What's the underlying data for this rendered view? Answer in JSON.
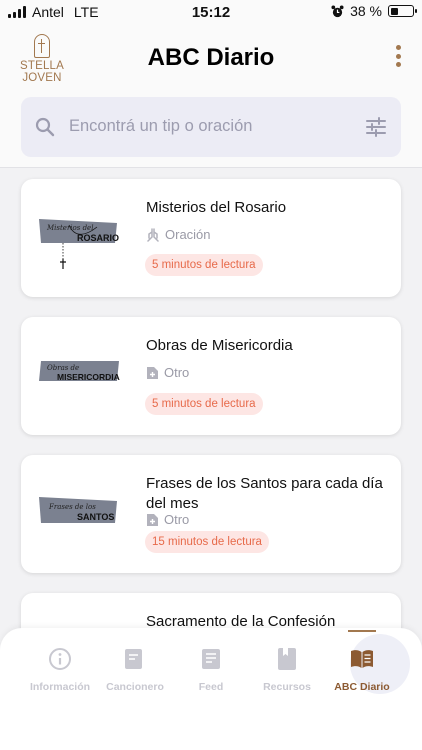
{
  "status_bar": {
    "carrier": "Antel",
    "network": "LTE",
    "time": "15:12",
    "battery": "38 %",
    "battery_level": 0.38,
    "alarm_icon": "alarm-clock-icon"
  },
  "header": {
    "logo": {
      "line1": "STELLA",
      "line2": "JOVEN",
      "color": "#a2784f"
    },
    "title": "ABC Diario",
    "menu_icon": "kebab-menu-icon"
  },
  "search": {
    "placeholder": "Encontrá un tip o oración",
    "icon": "search-icon",
    "filter_icon": "sliders-icon"
  },
  "cards": [
    {
      "title": "Misterios del Rosario",
      "thumb_script": "Misterios del",
      "thumb_bold": "ROSARIO",
      "category": "Oración",
      "category_icon": "praying-hands-icon",
      "badge": "5 minutos de lectura"
    },
    {
      "title": "Obras de Misericordia",
      "thumb_script": "Obras de",
      "thumb_bold": "MISERICORDIA",
      "category": "Otro",
      "category_icon": "document-plus-icon",
      "badge": "5 minutos de lectura"
    },
    {
      "title": "Frases de los Santos para cada día del mes",
      "thumb_script": "Frases de los",
      "thumb_bold": "SANTOS",
      "category": "Otro",
      "category_icon": "document-plus-icon",
      "badge": "15 minutos de lectura"
    },
    {
      "title": "Sacramento de la Confesión"
    }
  ],
  "tabs": [
    {
      "label": "Información",
      "icon": "info-icon"
    },
    {
      "label": "Cancionero",
      "icon": "songbook-icon"
    },
    {
      "label": "Feed",
      "icon": "feed-icon"
    },
    {
      "label": "Recursos",
      "icon": "bookmark-book-icon"
    },
    {
      "label": "ABC Diario",
      "icon": "open-book-icon",
      "active": true
    }
  ],
  "colors": {
    "accent": "#a2784f",
    "active_tab": "#8c5a32",
    "badge_bg": "#fde6e4",
    "badge_text": "#e76a4a",
    "search_bg": "#ececf5"
  }
}
